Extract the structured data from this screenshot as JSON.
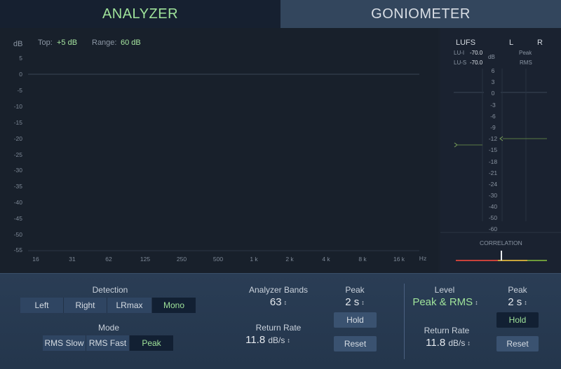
{
  "tabs": {
    "analyzer": "ANALYZER",
    "goniometer": "GONIOMETER"
  },
  "analyzer": {
    "db_unit": "dB",
    "top_label": "Top:",
    "top_value": "+5 dB",
    "range_label": "Range:",
    "range_value": "60 dB",
    "y_ticks": [
      "5",
      "0",
      "-5",
      "-10",
      "-15",
      "-20",
      "-25",
      "-30",
      "-35",
      "-40",
      "-45",
      "-50",
      "-55"
    ],
    "x_ticks": [
      "16",
      "31",
      "62",
      "125",
      "250",
      "500",
      "1 k",
      "2 k",
      "4 k",
      "8 k",
      "16 k",
      "Hz"
    ]
  },
  "meters": {
    "lufs_label": "LUFS",
    "l_label": "L",
    "r_label": "R",
    "lui_label": "LU-I",
    "lui_value": "-70.0",
    "lus_label": "LU-S",
    "lus_value": "-70.0",
    "db_unit": "dB",
    "peak_label": "Peak",
    "rms_label": "RMS",
    "scale": [
      "6",
      "3",
      "0",
      "-3",
      "-6",
      "-9",
      "-12",
      "-15",
      "-18",
      "-21",
      "-24",
      "-30",
      "-40",
      "-50",
      "-60"
    ],
    "correlation_label": "CORRELATION",
    "colors": {
      "correlation_red": "#c9423a",
      "correlation_yellow": "#c8a53a",
      "correlation_green": "#6e9a3a"
    }
  },
  "controls": {
    "detection": {
      "label": "Detection",
      "options": [
        "Left",
        "Right",
        "LRmax",
        "Mono"
      ],
      "selected": "Mono"
    },
    "mode": {
      "label": "Mode",
      "options": [
        "RMS Slow",
        "RMS Fast",
        "Peak"
      ],
      "selected": "Peak"
    },
    "analyzer_bands": {
      "label": "Analyzer Bands",
      "value": "63"
    },
    "return_rate_left": {
      "label": "Return Rate",
      "value": "11.8",
      "unit": "dB/s"
    },
    "peak_left": {
      "label": "Peak",
      "value": "2 s",
      "hold": "Hold",
      "reset": "Reset"
    },
    "level": {
      "label": "Level",
      "value": "Peak & RMS"
    },
    "return_rate_right": {
      "label": "Return Rate",
      "value": "11.8",
      "unit": "dB/s"
    },
    "peak_right": {
      "label": "Peak",
      "value": "2 s",
      "hold": "Hold",
      "reset": "Reset"
    }
  },
  "colors": {
    "accent_green": "#9fe39a",
    "panel_blue": "#2a3d55"
  }
}
